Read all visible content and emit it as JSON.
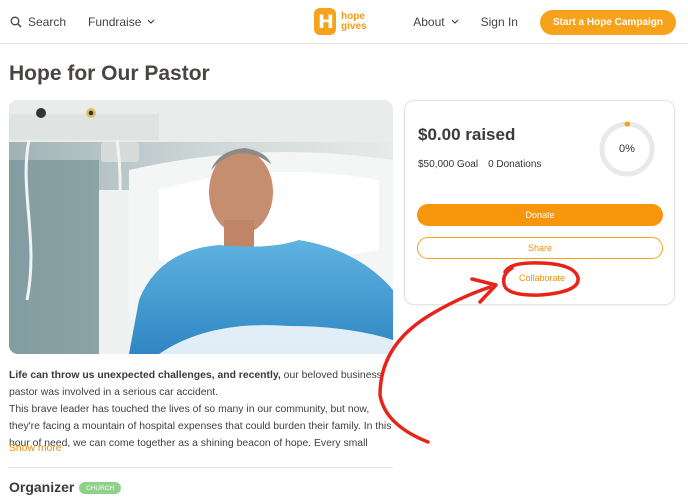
{
  "nav": {
    "search_label": "Search",
    "fundraise_label": "Fundraise",
    "logo_line1": "hope",
    "logo_line2": "gives",
    "logo_letter": "H",
    "about_label": "About",
    "signin_label": "Sign In",
    "cta_label": "Start a Hope Campaign"
  },
  "campaign": {
    "title": "Hope for Our Pastor",
    "raised": "$0.00 raised",
    "goal": "$50,000 Goal",
    "donations": "0 Donations",
    "progress_label": "0%",
    "progress_fraction": 0,
    "donate_label": "Donate",
    "share_label": "Share",
    "collaborate_label": "Collaborate"
  },
  "story": {
    "lead_bold": "Life can throw us unexpected challenges, and recently,",
    "lead_rest": " our beloved business pastor was involved in a serious car accident.",
    "para2": "This brave leader has touched the lives of so many in our community, but now, they're facing a mountain of hospital expenses that could burden their family. In this hour of need, we can come together as a shining beacon of hope. Every small",
    "show_more": "Show more"
  },
  "organizer": {
    "heading": "Organizer",
    "badge": "CHURCH"
  },
  "colors": {
    "brand": "#f7a21b",
    "annotation": "#e8231a",
    "badge": "#8fd18a"
  },
  "icons": [
    "search-icon",
    "chevron-down-icon",
    "hope-gives-logo"
  ]
}
